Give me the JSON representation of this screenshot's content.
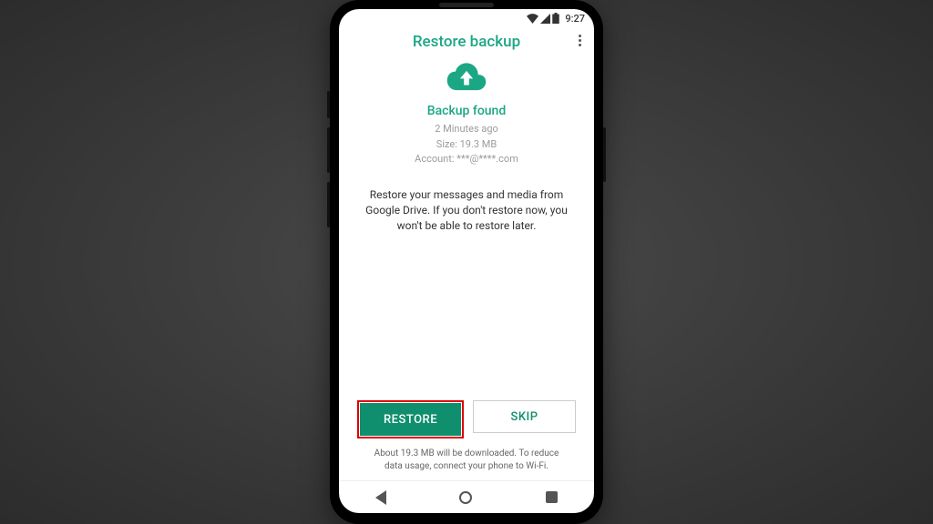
{
  "status": {
    "time": "9:27"
  },
  "header": {
    "title": "Restore backup"
  },
  "backup": {
    "found_label": "Backup found",
    "time_ago": "2 Minutes ago",
    "size_line": "Size: 19.3 MB",
    "account_line": "Account: ***@****.com"
  },
  "restore_message": "Restore your messages and media from Google Drive. If you don't restore now, you won't be able to restore later.",
  "buttons": {
    "restore": "RESTORE",
    "skip": "SKIP"
  },
  "footer_note": "About 19.3 MB will be downloaded. To reduce data usage, connect your phone to Wi-Fi.",
  "colors": {
    "accent": "#1ba784",
    "restore_btn": "#0f8f6d",
    "highlight": "#e00000"
  }
}
